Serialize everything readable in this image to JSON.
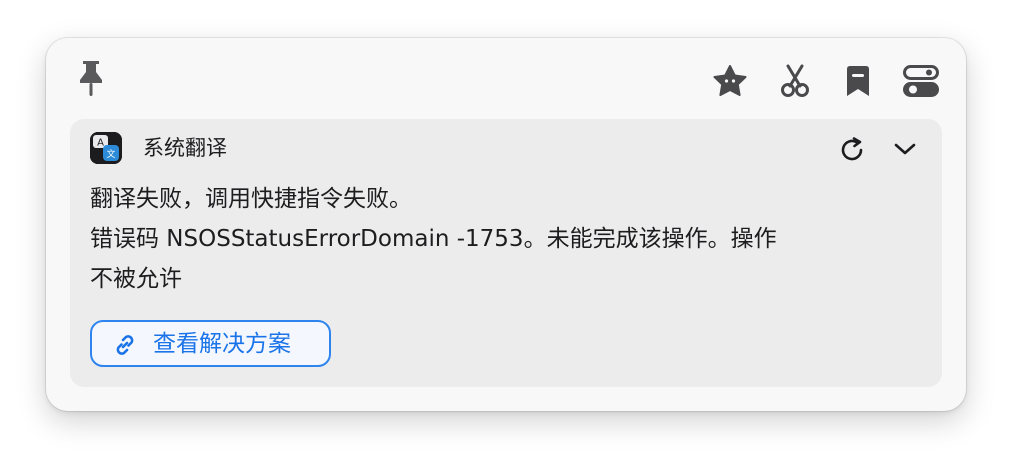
{
  "toolbar": {
    "pin_icon": "pin-icon",
    "icons": [
      "star-badge-icon",
      "scissors-icon",
      "bookmark-icon",
      "toggle-switch-icon"
    ]
  },
  "service": {
    "name": "系统翻译",
    "icon": "apple-translate-app-icon",
    "actions": [
      "refresh-icon",
      "chevron-down-icon"
    ]
  },
  "message": {
    "lines": [
      "翻译失败，调用快捷指令失败。",
      "错误码 NSOSStatusErrorDomain -1753。未能完成该操作。操作",
      "不被允许"
    ]
  },
  "solution_button": {
    "label": "查看解决方案",
    "icon": "link-icon"
  },
  "colors": {
    "accent": "#2f84f0",
    "text": "#1d1d1f",
    "icon_gray": "#4a4a4c",
    "card_bg": "#ececec",
    "window_bg": "#f8f8f8"
  }
}
